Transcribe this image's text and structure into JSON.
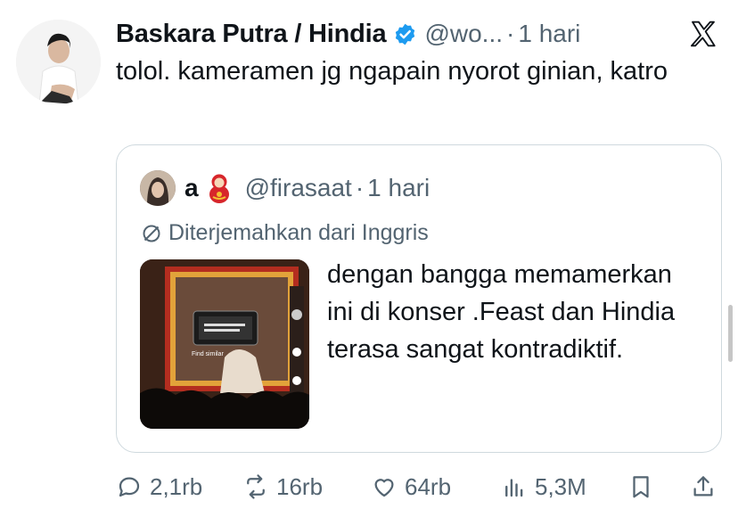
{
  "tweet": {
    "author_name": "Baskara Putra / Hindia",
    "handle": "@wo...",
    "separator": "·",
    "time": "1 hari",
    "text": "tolol. kameramen jg ngapain nyorot ginian, katro"
  },
  "quote": {
    "author_name": "a",
    "handle": "@firasaat",
    "separator": "·",
    "time": "1 hari",
    "translated_label": "Diterjemahkan dari Inggris",
    "text": "dengan bangga memamerkan ini di konser .Feast dan Hindia terasa sangat kontradiktif.",
    "thumbnail": {
      "find_similar_label": "Find similar"
    }
  },
  "actions": {
    "replies": "2,1rb",
    "reposts": "16rb",
    "likes": "64rb",
    "views": "5,3M"
  },
  "colors": {
    "text": "#0f1419",
    "muted": "#536471",
    "border": "#cfd9de",
    "verified": "#1d9bf0"
  },
  "icons": [
    "x-logo-icon",
    "verified-badge-icon",
    "matryoshka-doll-icon",
    "translate-icon",
    "reply-icon",
    "repost-icon",
    "like-icon",
    "views-icon",
    "bookmark-icon",
    "share-icon"
  ]
}
